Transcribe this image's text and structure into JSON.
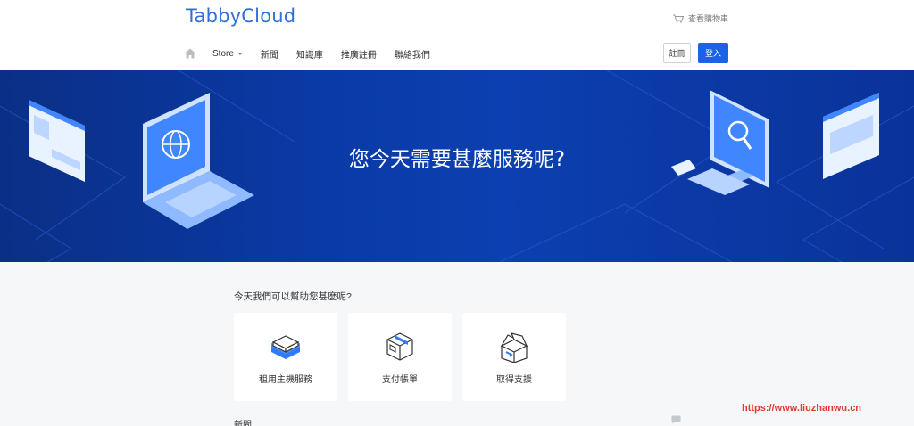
{
  "brand": {
    "name": "TabbyCloud",
    "color": "#2f6fd6"
  },
  "header": {
    "cart_label": "查看購物車",
    "cart_icon": "cart-icon"
  },
  "nav": {
    "home_icon": "home-icon",
    "items": [
      {
        "label": "Store",
        "has_dropdown": true
      },
      {
        "label": "新聞"
      },
      {
        "label": "知識庫"
      },
      {
        "label": "推廣註冊"
      },
      {
        "label": "聯絡我們"
      }
    ]
  },
  "auth": {
    "register_label": "註冊",
    "login_label": "登入",
    "accent": "#1b62e8"
  },
  "hero": {
    "title": "您今天需要甚麼服務呢?"
  },
  "help": {
    "title": "今天我們可以幫助您甚麼呢?",
    "cards": [
      {
        "label": "租用主機服務",
        "icon": "server-box-icon"
      },
      {
        "label": "支付帳單",
        "icon": "package-icon"
      },
      {
        "label": "取得支援",
        "icon": "open-box-icon"
      }
    ]
  },
  "news": {
    "title": "新聞",
    "icon": "comment-icon"
  },
  "watermark": {
    "text": "https://www.liuzhanwu.cn"
  }
}
